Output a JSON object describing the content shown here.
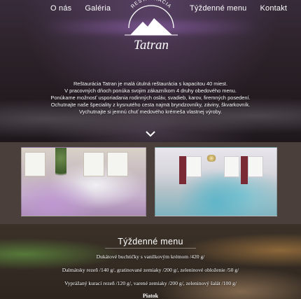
{
  "nav": {
    "left": [
      "O nás",
      "Galéria"
    ],
    "right": [
      "Týždenné menu",
      "Kontakt"
    ]
  },
  "logo": {
    "top_text": "RESTAURÁCIA",
    "name": "Tatran"
  },
  "hero": {
    "lines": [
      "Reštaurácia Tatran je malá útulná reštaurácia s kapacitou 40 miest.",
      "V pracovných dňoch ponúka svojim zákazníkom 4 druhy obedového menu.",
      "Ponúkame možnosť usporiadania rodinných osláv, svadieb, karov, firemných posedení.",
      "Ochutnajte naše špeciality z kysnutého cesta najmä bryndzovníky, záviny, škvarkovník.",
      "Vychutnajte si jemnú chuť medového krémeša vlastnej výroby."
    ]
  },
  "gallery": {
    "photos": [
      "dining-hall-purple-photo",
      "dining-hall-turquoise-photo"
    ]
  },
  "menu": {
    "title": "Týždenné menu",
    "items": [
      "Dukátové buchtičky s vanilkovým krémom /420 g/",
      "Dalmátsky rezeň /140 g/, gratinované zemiaky /200 g/, zeleninové obloženie /50 g/",
      "Vyprážaný kurací rezeň /120 g/, varené zemiaky /200 g/, zeleninový šalát /100 g/"
    ],
    "day": "Piatok"
  }
}
